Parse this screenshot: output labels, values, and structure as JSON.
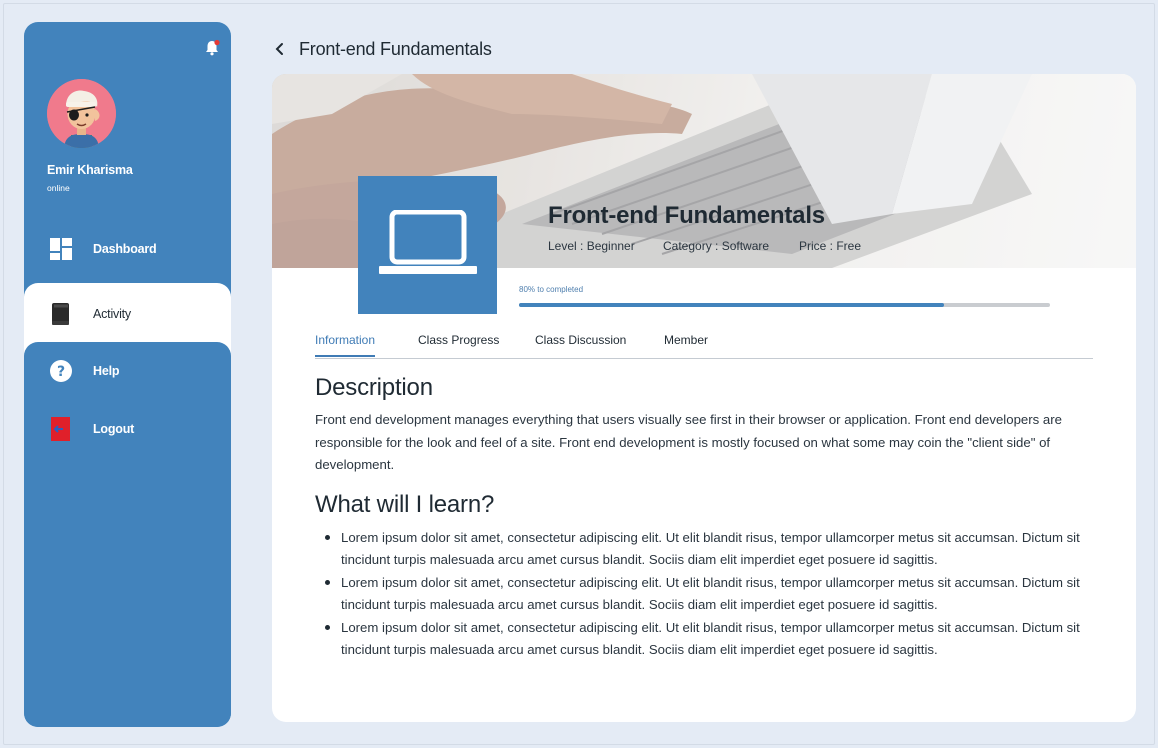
{
  "sidebar": {
    "user": {
      "name": "Emir Kharisma",
      "status": "online"
    },
    "items": [
      {
        "label": "Dashboard",
        "icon": "dashboard-grid-icon",
        "active": false
      },
      {
        "label": "Activity",
        "icon": "book-icon",
        "active": true
      },
      {
        "label": "Help",
        "icon": "question-icon",
        "active": false
      },
      {
        "label": "Logout",
        "icon": "logout-icon",
        "active": false
      }
    ],
    "notification_icon": "bell-icon"
  },
  "header": {
    "title": "Front-end Fundamentals",
    "back_icon": "chevron-left-icon"
  },
  "course": {
    "title": "Front-end Fundamentals",
    "level": "Level : Beginner",
    "category": "Category : Software",
    "price": "Price : Free",
    "thumbnail_icon": "laptop-icon",
    "progress_label": "80% to completed",
    "progress": 0.8
  },
  "tabs": [
    {
      "label": "Information",
      "active": true
    },
    {
      "label": "Class Progress",
      "active": false
    },
    {
      "label": "Class Discussion",
      "active": false
    },
    {
      "label": "Member",
      "active": false
    }
  ],
  "content": {
    "description_heading": "Description",
    "description": "Front end development manages everything that users visually see first in their browser or application. Front end developers are responsible for the look and feel of a site. Front end development is mostly focused on what some may coin the \"client side\" of development.",
    "learn_heading": "What will I learn?",
    "learn_items": [
      "Lorem ipsum dolor sit amet, consectetur adipiscing elit. Ut elit blandit risus, tempor ullamcorper metus sit accumsan. Dictum sit tincidunt turpis malesuada arcu amet cursus blandit. Sociis diam elit imperdiet eget posuere id sagittis.",
      "Lorem ipsum dolor sit amet, consectetur adipiscing elit. Ut elit blandit risus, tempor ullamcorper metus sit accumsan. Dictum sit tincidunt turpis malesuada arcu amet cursus blandit. Sociis diam elit imperdiet eget posuere id sagittis.",
      "Lorem ipsum dolor sit amet, consectetur adipiscing elit. Ut elit blandit risus, tempor ullamcorper metus sit accumsan. Dictum sit tincidunt turpis malesuada arcu amet cursus blandit. Sociis diam elit imperdiet eget posuere id sagittis."
    ]
  },
  "colors": {
    "primary": "#4283bc",
    "background": "#e4ebf5",
    "notification_dot": "#e53935",
    "logout": "#e0202a"
  }
}
